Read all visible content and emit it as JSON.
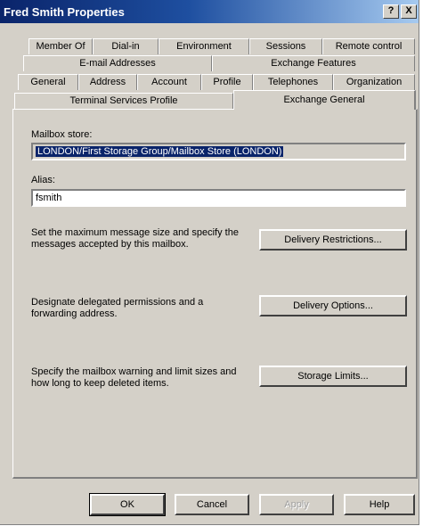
{
  "window": {
    "title": "Fred Smith Properties",
    "help_button": "?",
    "close_button": "X"
  },
  "tabs": {
    "row1": [
      "Member Of",
      "Dial-in",
      "Environment",
      "Sessions",
      "Remote control"
    ],
    "row2": [
      "E-mail Addresses",
      "Exchange Features"
    ],
    "row3": [
      "General",
      "Address",
      "Account",
      "Profile",
      "Telephones",
      "Organization"
    ],
    "row4": [
      "Terminal Services Profile",
      "Exchange General"
    ],
    "active": "Exchange General"
  },
  "panel": {
    "mailbox_store_label": "Mailbox store:",
    "mailbox_store_value": "LONDON/First Storage Group/Mailbox Store (LONDON)",
    "alias_label": "Alias:",
    "alias_value": "fsmith",
    "delivery_restrictions_desc": "Set the maximum message size and specify the messages accepted by this mailbox.",
    "delivery_restrictions_button": "Delivery Restrictions...",
    "delivery_options_desc": "Designate delegated permissions and a forwarding address.",
    "delivery_options_button": "Delivery Options...",
    "storage_limits_desc": "Specify the mailbox warning and limit sizes and how long to keep deleted items.",
    "storage_limits_button": "Storage Limits..."
  },
  "footer": {
    "ok": "OK",
    "cancel": "Cancel",
    "apply": "Apply",
    "help": "Help"
  }
}
